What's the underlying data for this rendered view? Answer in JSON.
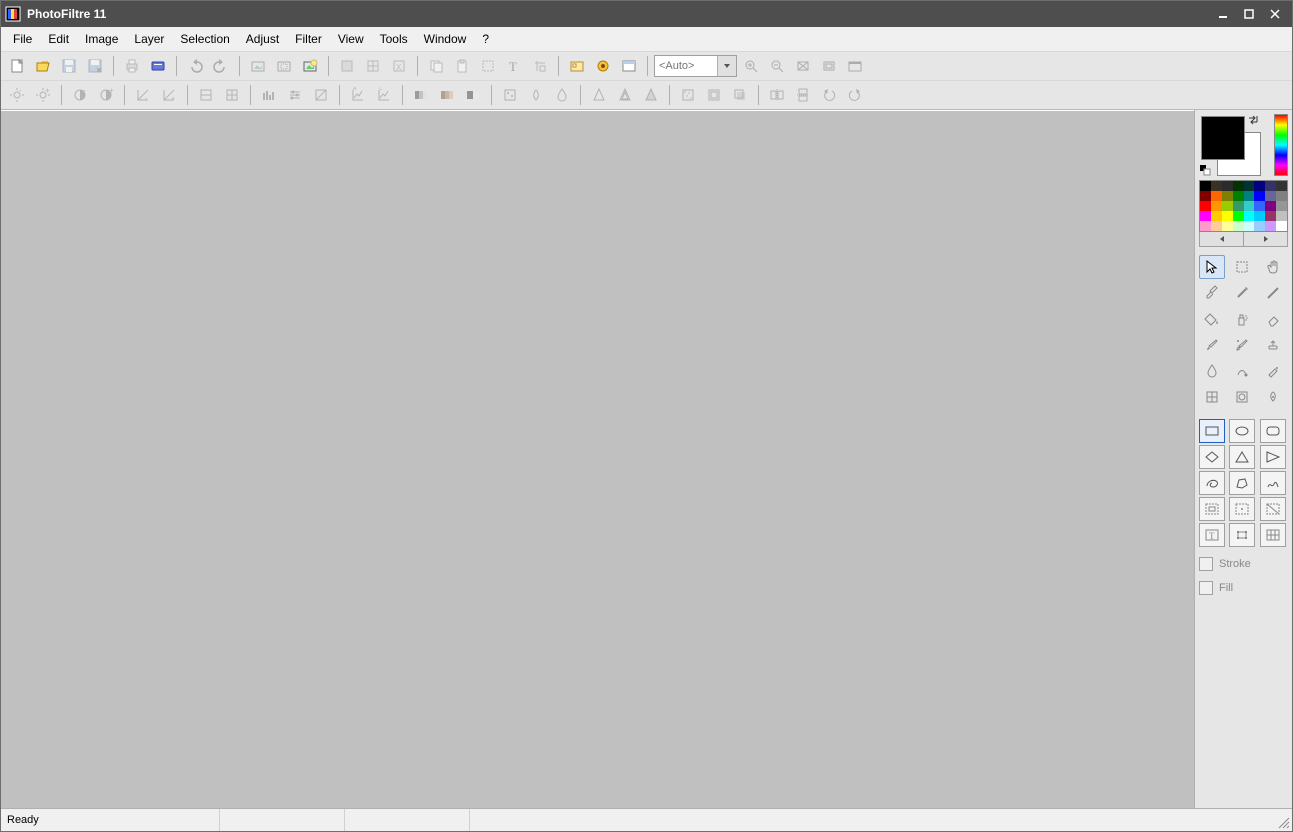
{
  "app": {
    "title": "PhotoFiltre 11"
  },
  "menu": {
    "items": [
      "File",
      "Edit",
      "Image",
      "Layer",
      "Selection",
      "Adjust",
      "Filter",
      "View",
      "Tools",
      "Window",
      "?"
    ]
  },
  "toolbar": {
    "zoom_placeholder": "<Auto>"
  },
  "side": {
    "fg_color": "#000000",
    "bg_color": "#ffffff",
    "palette": [
      "#000000",
      "#3b3121",
      "#2b2b2b",
      "#003300",
      "#003333",
      "#000080",
      "#333366",
      "#333333",
      "#800000",
      "#ff6600",
      "#808000",
      "#008000",
      "#008080",
      "#0000ff",
      "#666699",
      "#808080",
      "#ff0000",
      "#ff9900",
      "#99cc00",
      "#339966",
      "#33cccc",
      "#3366ff",
      "#800080",
      "#969696",
      "#ff00ff",
      "#ffcc00",
      "#ffff00",
      "#00ff00",
      "#00ffff",
      "#00ccff",
      "#993366",
      "#c0c0c0",
      "#ff99cc",
      "#ffcc99",
      "#ffff99",
      "#ccffcc",
      "#ccffff",
      "#99ccff",
      "#cc99ff",
      "#ffffff"
    ],
    "stroke_label": "Stroke",
    "fill_label": "Fill"
  },
  "status": {
    "text": "Ready"
  }
}
